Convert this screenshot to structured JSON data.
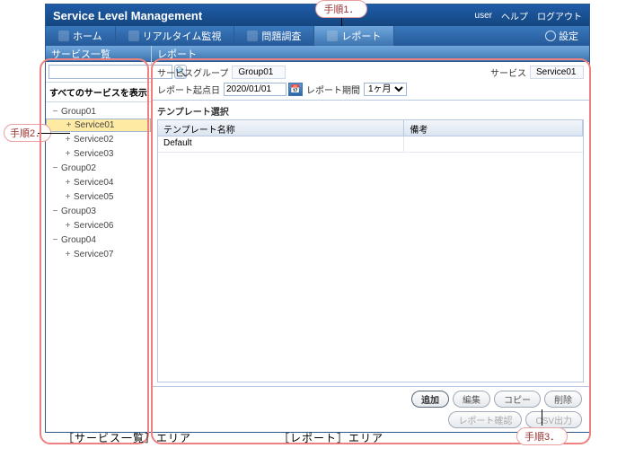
{
  "annotations": {
    "step1": "手順1．",
    "step2": "手順2．",
    "step3": "手順3．",
    "caption_left": "［サービス一覧］エリア",
    "caption_right": "［レポート］エリア"
  },
  "header": {
    "title": "Service Level Management",
    "user": "user",
    "help": "ヘルプ",
    "logout": "ログアウト"
  },
  "tabs": {
    "home": "ホーム",
    "realtime": "リアルタイム監視",
    "investigate": "問題調査",
    "report": "レポート",
    "settings": "設定"
  },
  "sidebar": {
    "panel_title": "サービス一覧",
    "search_placeholder": "",
    "show_all": "すべてのサービスを表示",
    "tree": [
      {
        "type": "group",
        "label": "Group01",
        "expanded": true
      },
      {
        "type": "service",
        "label": "Service01",
        "selected": true
      },
      {
        "type": "service",
        "label": "Service02"
      },
      {
        "type": "service",
        "label": "Service03"
      },
      {
        "type": "group",
        "label": "Group02",
        "expanded": true
      },
      {
        "type": "service",
        "label": "Service04"
      },
      {
        "type": "service",
        "label": "Service05"
      },
      {
        "type": "group",
        "label": "Group03",
        "expanded": true
      },
      {
        "type": "service",
        "label": "Service06"
      },
      {
        "type": "group",
        "label": "Group04",
        "expanded": true
      },
      {
        "type": "service",
        "label": "Service07"
      }
    ]
  },
  "main": {
    "panel_title": "レポート",
    "filters": {
      "group_label": "サービスグループ",
      "group_value": "Group01",
      "service_label": "サービス",
      "service_value": "Service01",
      "date_label": "レポート起点日",
      "date_value": "2020/01/01",
      "period_label": "レポート期間",
      "period_value": "1ヶ月"
    },
    "template_section": "テンプレート選択",
    "grid": {
      "cols": {
        "name": "テンプレート名称",
        "remark": "備考"
      },
      "rows": [
        {
          "name": "Default",
          "remark": ""
        }
      ]
    },
    "buttons": {
      "add": "追加",
      "edit": "編集",
      "copy": "コピー",
      "del": "削除",
      "confirm": "レポート確認",
      "csv": "CSV出力"
    }
  }
}
